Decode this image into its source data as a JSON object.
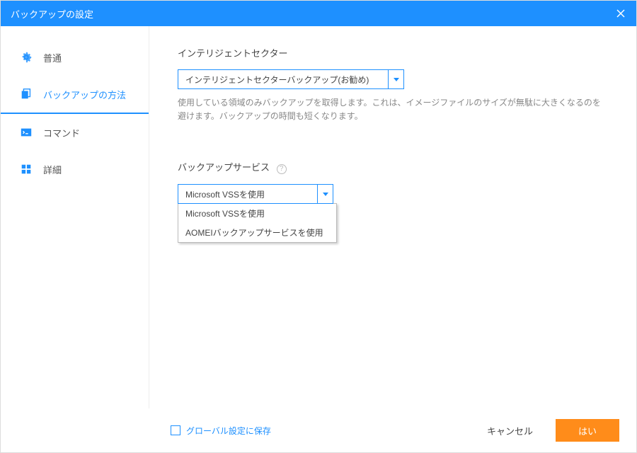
{
  "titlebar": {
    "title": "バックアップの設定"
  },
  "sidebar": {
    "items": [
      {
        "label": "普通"
      },
      {
        "label": "バックアップの方法"
      },
      {
        "label": "コマンド"
      },
      {
        "label": "詳細"
      }
    ]
  },
  "content": {
    "intelligent_sector": {
      "label": "インテリジェントセクター",
      "selected": "インテリジェントセクターバックアップ(お勧め)",
      "desc": "使用している領域のみバックアップを取得します。これは、イメージファイルのサイズが無駄に大きくなるのを避けます。バックアップの時間も短くなります。"
    },
    "backup_service": {
      "label": "バックアップサービス",
      "selected": "Microsoft VSSを使用",
      "options": [
        "Microsoft VSSを使用",
        "AOMEIバックアップサービスを使用"
      ]
    }
  },
  "footer": {
    "save_global": "グローバル設定に保存",
    "cancel": "キャンセル",
    "ok": "はい"
  }
}
